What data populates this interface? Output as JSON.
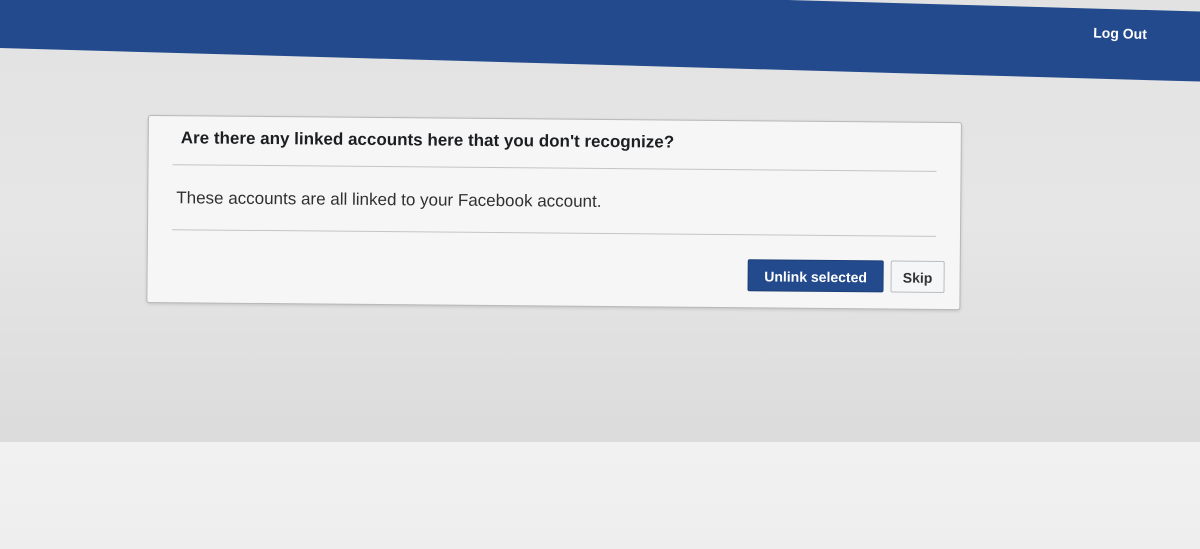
{
  "topbar": {
    "logout_label": "Log Out",
    "color": "#234a8c"
  },
  "dialog": {
    "title": "Are there any linked accounts here that you don't recognize?",
    "body": "These accounts are all linked to your Facebook account.",
    "unlink_label": "Unlink selected",
    "skip_label": "Skip",
    "primary_color": "#234a8c"
  }
}
